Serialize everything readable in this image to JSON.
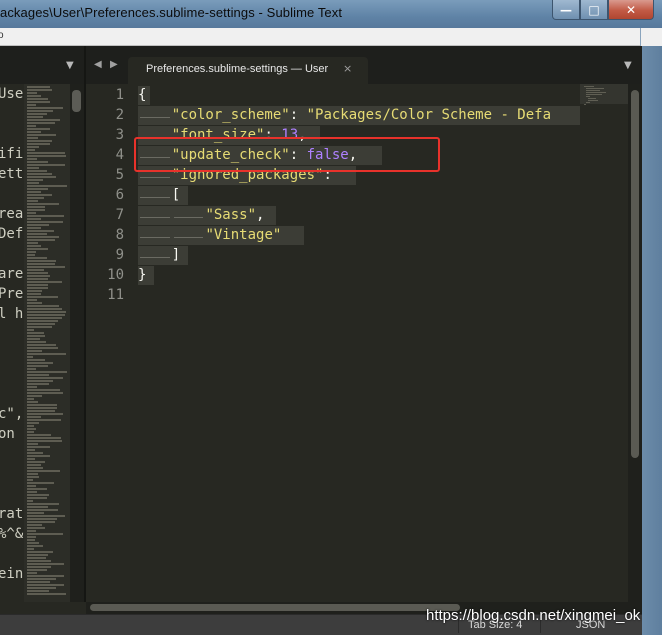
{
  "window": {
    "title": "ackages\\User\\Preferences.sublime-settings - Sublime Text",
    "controls": {
      "minimize": "—",
      "maximize": "□",
      "close": "✕"
    }
  },
  "menubar": {
    "hint": "o"
  },
  "tabs": {
    "active_label": "Preferences.sublime-settings — User",
    "close_icon": "×",
    "nav_prev": "◀",
    "nav_next": "▶",
    "dropdown": "▼"
  },
  "left_pane_fragments": [
    {
      "text": "Use"
    },
    {
      "text": "ifi"
    },
    {
      "text": "ett"
    },
    {
      "text": "rea"
    },
    {
      "text": "Def"
    },
    {
      "text": "are"
    },
    {
      "text": "Pre"
    },
    {
      "text": "l h"
    },
    {
      "text": "c\","
    },
    {
      "text": " on"
    },
    {
      "text": "rat"
    },
    {
      "text": "%^&"
    },
    {
      "text": "ein"
    }
  ],
  "editor": {
    "line_numbers": [
      "1",
      "2",
      "3",
      "4",
      "5",
      "6",
      "7",
      "8",
      "9",
      "10",
      "11"
    ],
    "lines": [
      {
        "parts": [
          {
            "t": "{",
            "c": "plain"
          }
        ]
      },
      {
        "parts": [
          {
            "t": "\"color_scheme\"",
            "c": "str"
          },
          {
            "t": ": ",
            "c": "plain"
          },
          {
            "t": "\"Packages/Color Scheme - Defa",
            "c": "str"
          }
        ]
      },
      {
        "parts": [
          {
            "t": "\"font_size\"",
            "c": "str"
          },
          {
            "t": ": ",
            "c": "plain"
          },
          {
            "t": "13",
            "c": "num"
          },
          {
            "t": ",",
            "c": "plain"
          }
        ]
      },
      {
        "parts": [
          {
            "t": "\"update_check\"",
            "c": "str"
          },
          {
            "t": ": ",
            "c": "plain"
          },
          {
            "t": "false",
            "c": "kw"
          },
          {
            "t": ",",
            "c": "plain"
          }
        ]
      },
      {
        "parts": [
          {
            "t": "\"ignored_packages\"",
            "c": "str"
          },
          {
            "t": ":",
            "c": "plain"
          }
        ]
      },
      {
        "parts": [
          {
            "t": "[",
            "c": "plain"
          }
        ]
      },
      {
        "parts": [
          {
            "t": "\"Sass\"",
            "c": "str"
          },
          {
            "t": ",",
            "c": "plain"
          }
        ]
      },
      {
        "parts": [
          {
            "t": "\"Vintage\"",
            "c": "str"
          }
        ]
      },
      {
        "parts": [
          {
            "t": "]",
            "c": "plain"
          }
        ]
      },
      {
        "parts": [
          {
            "t": "}",
            "c": "plain"
          }
        ]
      },
      {
        "parts": []
      }
    ]
  },
  "statusbar": {
    "tab_size": "Tab Size: 4",
    "syntax": "JSON"
  },
  "watermark": "https://blog.csdn.net/xingmei_ok",
  "colors": {
    "background": "#272822",
    "string": "#e6db74",
    "constant": "#ae81ff",
    "highlight_box": "#e8322b"
  }
}
